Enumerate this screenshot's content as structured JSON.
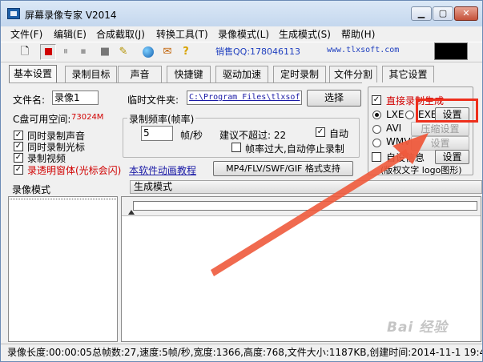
{
  "window": {
    "title": "屏幕录像专家 V2014"
  },
  "menu": [
    "文件(F)",
    "编辑(E)",
    "合成截取(J)",
    "转换工具(T)",
    "录像模式(L)",
    "生成模式(S)",
    "帮助(H)"
  ],
  "toolbar": {
    "qq": "销售QQ:178046113",
    "site": "www.tlxsoft.com"
  },
  "tabs": [
    "基本设置",
    "录制目标",
    "声音",
    "快捷键",
    "驱动加速",
    "定时录制",
    "文件分割",
    "其它设置"
  ],
  "basic": {
    "filename_label": "文件名:",
    "filename_value": "录像1",
    "tempfolder_label": "临时文件夹:",
    "tempfolder_value": "C:\\Program Files\\tlxsof",
    "select_button": "选择",
    "disk_label": "C盘可用空间:",
    "disk_value": "73024M",
    "cb_sound": "同时录制声音",
    "cb_cursor": "同时录制光标",
    "cb_video": "录制视频",
    "cb_transparent": "录透明窗体(光标会闪)",
    "freq_group": "录制频率(帧率)",
    "fps_value": "5",
    "fps_unit": "帧/秒",
    "suggest": "建议不超过: 22",
    "auto": "自动",
    "auto_stop": "帧率过大,自动停止录制",
    "tutorial_link": "本软件动画教程",
    "format_button": "MP4/FLV/SWF/GIF  格式支持"
  },
  "right": {
    "direct": "直接录制生成",
    "lxe": "LXE",
    "exe": "EXE",
    "avi": "AVI",
    "wmv": "WMV",
    "settings": "设置",
    "compress_settings": "压缩设置",
    "settings2": "设置",
    "selfinfo": "自设信息",
    "settings3": "设置",
    "copyright": "(版权文字 logo图形)"
  },
  "lower": {
    "record_mode": "录像模式",
    "generate_mode": "生成模式"
  },
  "status": "录像长度:00:00:05总帧数:27,速度:5帧/秒,宽度:1366,高度:768,文件大小:1187KB,创建时间:2014-11-1 19:4",
  "watermark": "Bai 经验",
  "colors": {
    "accent_red": "#ee2f1c",
    "link_blue": "#1a1aa6"
  }
}
